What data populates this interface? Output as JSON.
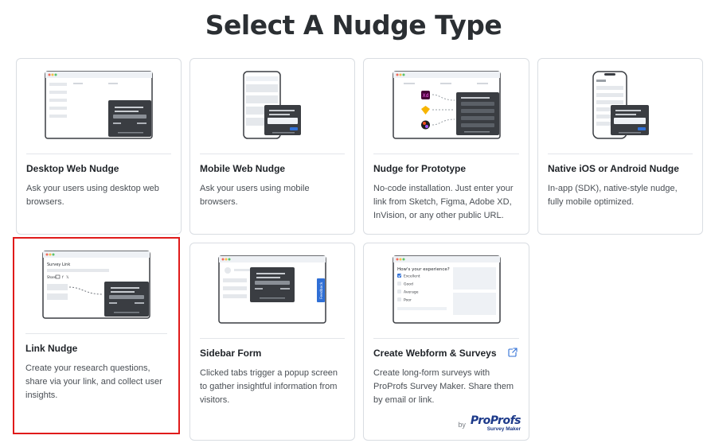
{
  "page": {
    "title": "Select A Nudge Type"
  },
  "cards": [
    {
      "title": "Desktop Web Nudge",
      "description": "Ask your users using desktop web browsers."
    },
    {
      "title": "Mobile Web Nudge",
      "description": "Ask your users using mobile browsers."
    },
    {
      "title": "Nudge for Prototype",
      "description": "No-code installation. Just enter your link from Sketch, Figma, Adobe XD, InVision, or any other public URL."
    },
    {
      "title": "Native iOS or Android Nudge",
      "description": "In-app (SDK), native-style nudge, fully mobile optimized."
    },
    {
      "title": "Link Nudge",
      "description": "Create your research questions, share via your link, and collect user insights."
    },
    {
      "title": "Sidebar Form",
      "description": "Clicked tabs trigger a popup screen to gather insightful information from visitors."
    },
    {
      "title": "Create Webform & Surveys",
      "description": "Create long-form surveys with ProProfs Survey Maker. Share them by email or link."
    }
  ],
  "illustrations": {
    "link_nudge": {
      "caption": "Survey Link",
      "share_label": "Share"
    },
    "sidebar_form": {
      "tab_label": "Feedback"
    },
    "webform": {
      "question": "How's your experience?",
      "options": [
        "Excellent",
        "Good",
        "Average",
        "Poor"
      ],
      "selected_option": "Excellent"
    },
    "prototype": {
      "xd_badge": "Xd"
    }
  },
  "branding": {
    "by_label": "by",
    "logo_name": "ProProfs",
    "logo_sub": "Survey Maker"
  },
  "colors": {
    "selected_border": "#e01b1b",
    "accent_blue": "#2f6fd6",
    "popup_dark": "#3a3d42",
    "xd_purple": "#470137",
    "sketch_yellow": "#f7b500"
  },
  "icons": {
    "external_link": "external-link-icon"
  }
}
